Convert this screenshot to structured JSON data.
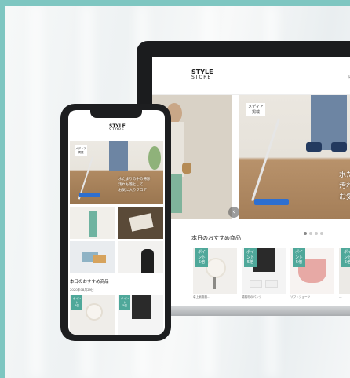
{
  "brand": {
    "line1": "STYLE",
    "line2": "STORE"
  },
  "laptop": {
    "nav_partial": "ログ",
    "hero_badge": "メディア\n掲載",
    "hero_text_lines": [
      "水た",
      "汚れ",
      "お気"
    ],
    "section_title": "本日のおすすめ商品",
    "products": [
      {
        "badge": "ポイント\n5倍",
        "caption": "卓上扇風機…"
      },
      {
        "badge": "ポイント\n5倍",
        "caption": "綿素材のパンツ"
      },
      {
        "badge": "ポイント\n5倍",
        "caption": "ソフトショーツ"
      },
      {
        "badge": "ポイント\n5倍",
        "caption": "…"
      }
    ]
  },
  "phone": {
    "hero_badge": "メディア\n掲載",
    "hero_text_lines": [
      "水たまりの中の掃除",
      "汚れも落として",
      "お気に入りフロア"
    ],
    "section_title": "本日のおすすめ商品",
    "date": "2020年08月29日",
    "thumb_badge": "ポイント\n5倍"
  },
  "colors": {
    "accent": "#4fa89a",
    "frame": "#7ec6c1"
  }
}
